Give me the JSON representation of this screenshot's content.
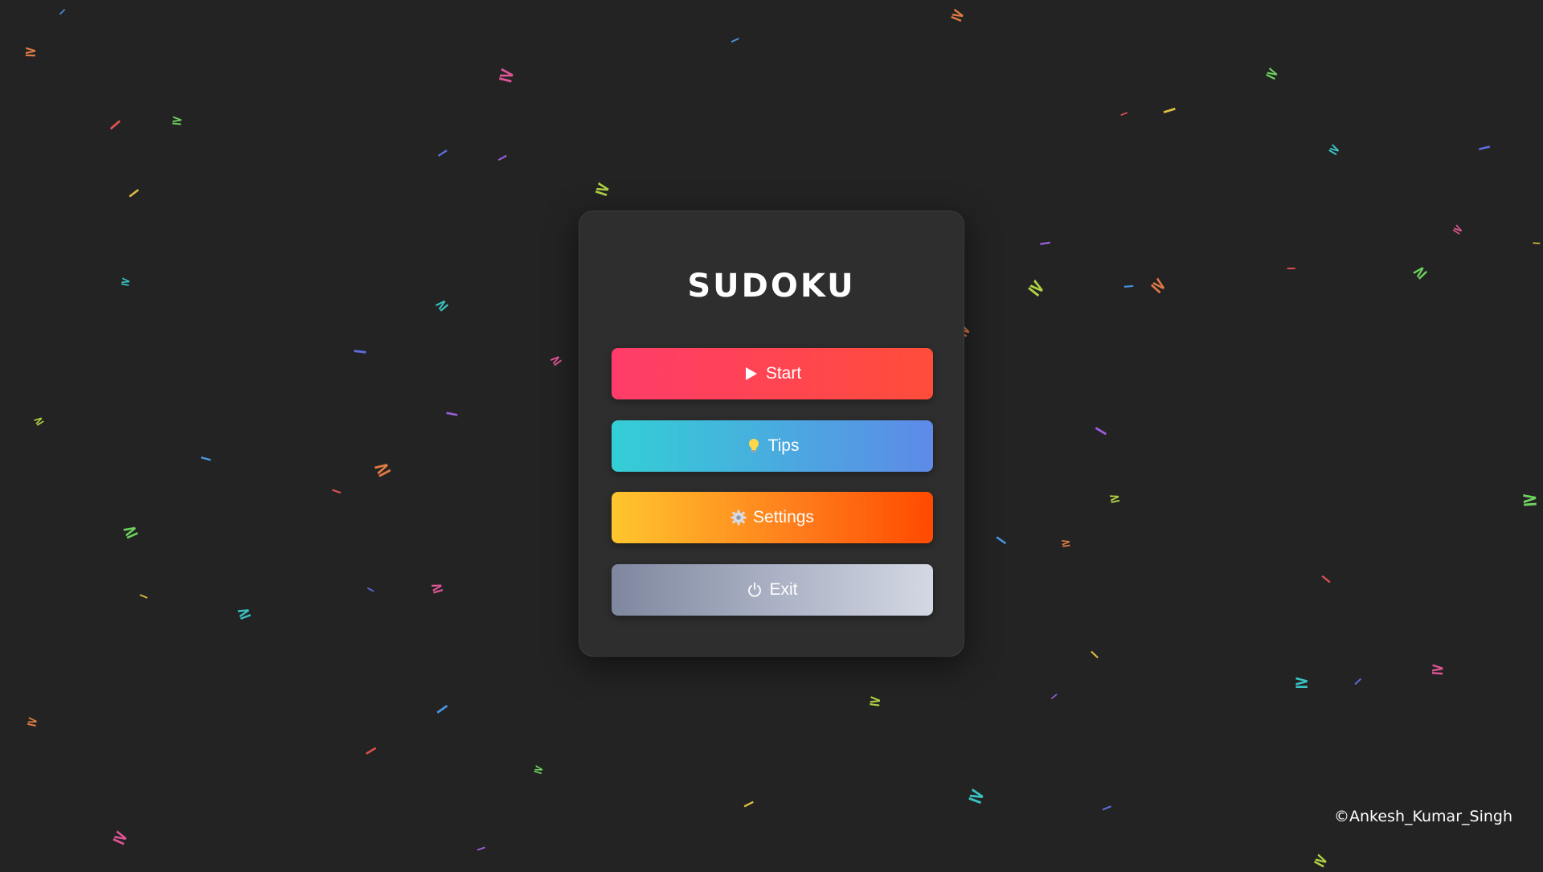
{
  "app": {
    "title": "SUDOKU",
    "copyright": "©Ankesh_Kumar_Singh"
  },
  "menu": {
    "start_label": "Start",
    "tips_label": "Tips",
    "settings_label": "Settings",
    "exit_label": "Exit"
  },
  "icons": {
    "start": "play-icon",
    "tips": "lightbulb-icon",
    "settings": "gear-icon",
    "exit": "power-icon"
  },
  "colors": {
    "background": "#232323",
    "card": "#2e2e2e",
    "start_gradient": [
      "#ff3c6a",
      "#ff4d3a"
    ],
    "tips_gradient": [
      "#33cfd6",
      "#5e8ae8"
    ],
    "settings_gradient": [
      "#ffc62e",
      "#ff4a00"
    ],
    "exit_gradient": [
      "#7f879f",
      "#d3d8e3"
    ]
  },
  "background_symbols": [
    "×",
    "÷",
    "+",
    "−",
    "=",
    "%",
    "<",
    ">",
    "≠",
    "≤",
    "≥",
    "^",
    "∧",
    "∨"
  ]
}
